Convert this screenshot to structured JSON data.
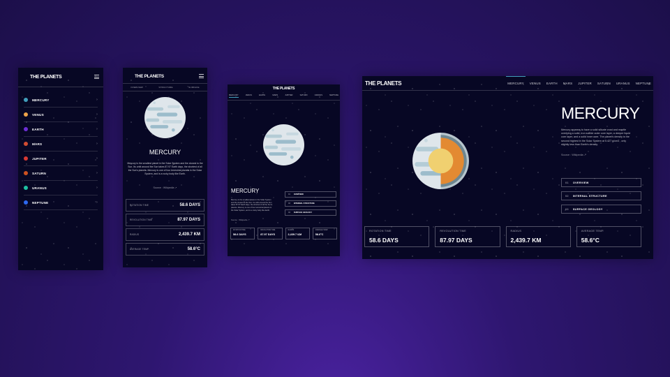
{
  "app": {
    "logo": "THE PLANETS"
  },
  "colors": {
    "background": "#070724",
    "accent": "#419ebb"
  },
  "menu": {
    "items": [
      {
        "label": "MERCURY",
        "color": "#419ebb"
      },
      {
        "label": "VENUS",
        "color": "#eda249"
      },
      {
        "label": "EARTH",
        "color": "#6d2ed5"
      },
      {
        "label": "MARS",
        "color": "#d14c32"
      },
      {
        "label": "JUPITER",
        "color": "#d83a34"
      },
      {
        "label": "SATURN",
        "color": "#cd5120"
      },
      {
        "label": "URANUS",
        "color": "#1ec1a2"
      },
      {
        "label": "NEPTUNE",
        "color": "#2d68f0"
      }
    ]
  },
  "nav": {
    "items": [
      "MERCURY",
      "VENUS",
      "EARTH",
      "MARS",
      "JUPITER",
      "SATURN",
      "URANUS",
      "NEPTUNE"
    ]
  },
  "mobile_tabs": [
    "OVERVIEW",
    "STRUCTURE",
    "SURFACE"
  ],
  "tablet_tabs": [
    "MERCURY",
    "VENUS",
    "EARTH",
    "MARS",
    "JUPITER",
    "SATURN",
    "URANUS",
    "NEPTUNE"
  ],
  "planet": {
    "name": "MERCURY",
    "overview_text": "Mercury is the smallest planet in the Solar System and the closest to the Sun. Its orbit around the Sun takes 87.97 Earth days, the shortest of all the Sun's planets. Mercury is one of four terrestrial planets in the Solar System, and is a rocky body like Earth.",
    "structure_text": "Mercury appears to have a solid silicate crust and mantle overlying a solid, iron sulfide outer core layer, a deeper liquid core layer, and a solid inner core. The planet's density is the second highest in the Solar System at 5.427 g/cm3 , only slightly less than Earth's density.",
    "source_label": "Source : Wikipedia"
  },
  "buttons": [
    {
      "num": "01",
      "label": "OVERVIEW"
    },
    {
      "num": "02",
      "label": "INTERNAL STRUCTURE"
    },
    {
      "num": "03",
      "label": "SURFACE GEOLOGY"
    }
  ],
  "stats": [
    {
      "label": "ROTATION TIME",
      "value": "58.6 DAYS"
    },
    {
      "label": "REVOLUTION TIME",
      "value": "87.97 DAYS"
    },
    {
      "label": "RADIUS",
      "value": "2,439.7 KM"
    },
    {
      "label": "AVERAGE TEMP.",
      "value": "58.6°C"
    }
  ]
}
